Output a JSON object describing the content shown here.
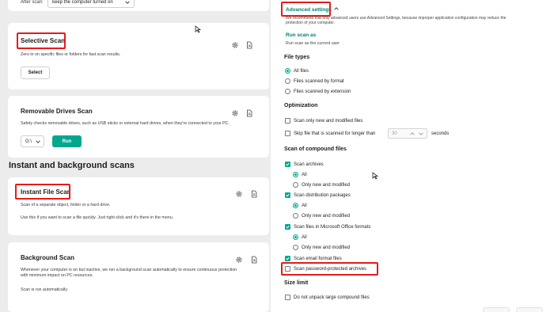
{
  "top_row": {
    "label": "After scan:",
    "select_value": "keep the computer turned on"
  },
  "selective_scan": {
    "title": "Selective Scan",
    "desc": "Zero in on specific files or folders for fast scan results.",
    "button": "Select"
  },
  "removable_scan": {
    "title": "Removable Drives Scan",
    "desc": "Safety checks removable drives, such as USB sticks or external hard drives, when they're connected to your PC.",
    "drive_value": "G:\\",
    "button": "Run"
  },
  "section_heading": "Instant and background scans",
  "instant_scan": {
    "title": "Instant File Scan",
    "desc1": "Scan of a separate object, folder or a hard drive.",
    "desc2": "Use this if you want to scan a file quickly. Just right-click and it's there in the menu."
  },
  "background_scan": {
    "title": "Background Scan",
    "desc1": "Whenever your computer is on but inactive, we run a background scan automatically to ensure continuous protection",
    "desc1b": "with minimum impact on PC resources.",
    "desc2": "Scan is run automatically."
  },
  "advanced": {
    "link": "Advanced settings",
    "warning1": "We recommend that only advanced users use Advanced Settings, because improper application configuration may reduce the",
    "warning2": "protection of your computer.",
    "run_as_link": "Run scan as",
    "run_as_desc": "Run scan as the current user"
  },
  "file_types": {
    "heading": "File types",
    "options": [
      "All files",
      "Files scanned by format",
      "Files scanned by extension"
    ]
  },
  "optimization": {
    "heading": "Optimization",
    "opt1": "Scan only new and modified files",
    "opt2": "Skip file that is scanned for longer than",
    "seconds_value": "30",
    "seconds_label": "seconds"
  },
  "compound": {
    "heading": "Scan of compound files",
    "archives": "Scan archives",
    "all1": "All",
    "only_new1": "Only new and modified",
    "distribution": "Scan distribution packages",
    "all2": "All",
    "only_new2": "Only new and modified",
    "office": "Scan files in Microsoft Office formats",
    "all3": "All",
    "only_new3": "Only new and modified",
    "email": "Scan email format files",
    "password": "Scan password-protected archives"
  },
  "size_limit": {
    "heading": "Size limit",
    "opt1": "Do not unpack large compound files"
  },
  "colors": {
    "accent": "#00a88e",
    "highlight": "#e41b1b",
    "link": "#00806c"
  },
  "icons": [
    "gear-icon",
    "document-icon",
    "chevron-down-icon",
    "chevron-up-icon",
    "check-icon",
    "mouse-cursor-icon"
  ]
}
